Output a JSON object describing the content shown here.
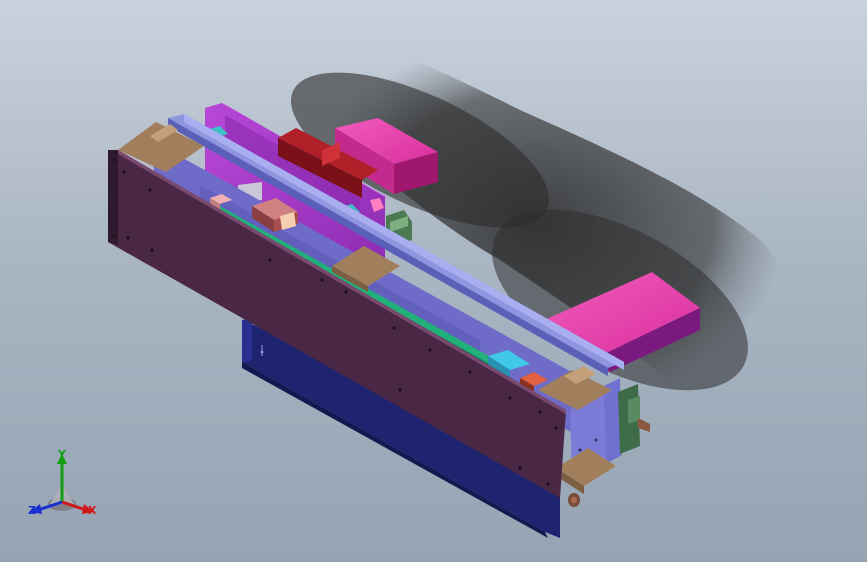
{
  "viewport": {
    "background_top": "#c9d2dc",
    "background_bottom": "#95a3b3"
  },
  "colors": {
    "front_plate": "#4a2745",
    "end_blocks": "#a27f5c",
    "rail": "#7f86d6",
    "magenta_block": "#e63aa8",
    "purple_plate": "#a838c8",
    "base_plate": "#1e2470",
    "green_strip": "#20a070",
    "motor_green": "#4b7a52",
    "red_block": "#8a1a20"
  },
  "axis_triad": {
    "x_label": "X",
    "y_label": "Y",
    "z_label": "Z",
    "x_color": "#d01818",
    "y_color": "#12a012",
    "z_color": "#1a2fd0"
  }
}
